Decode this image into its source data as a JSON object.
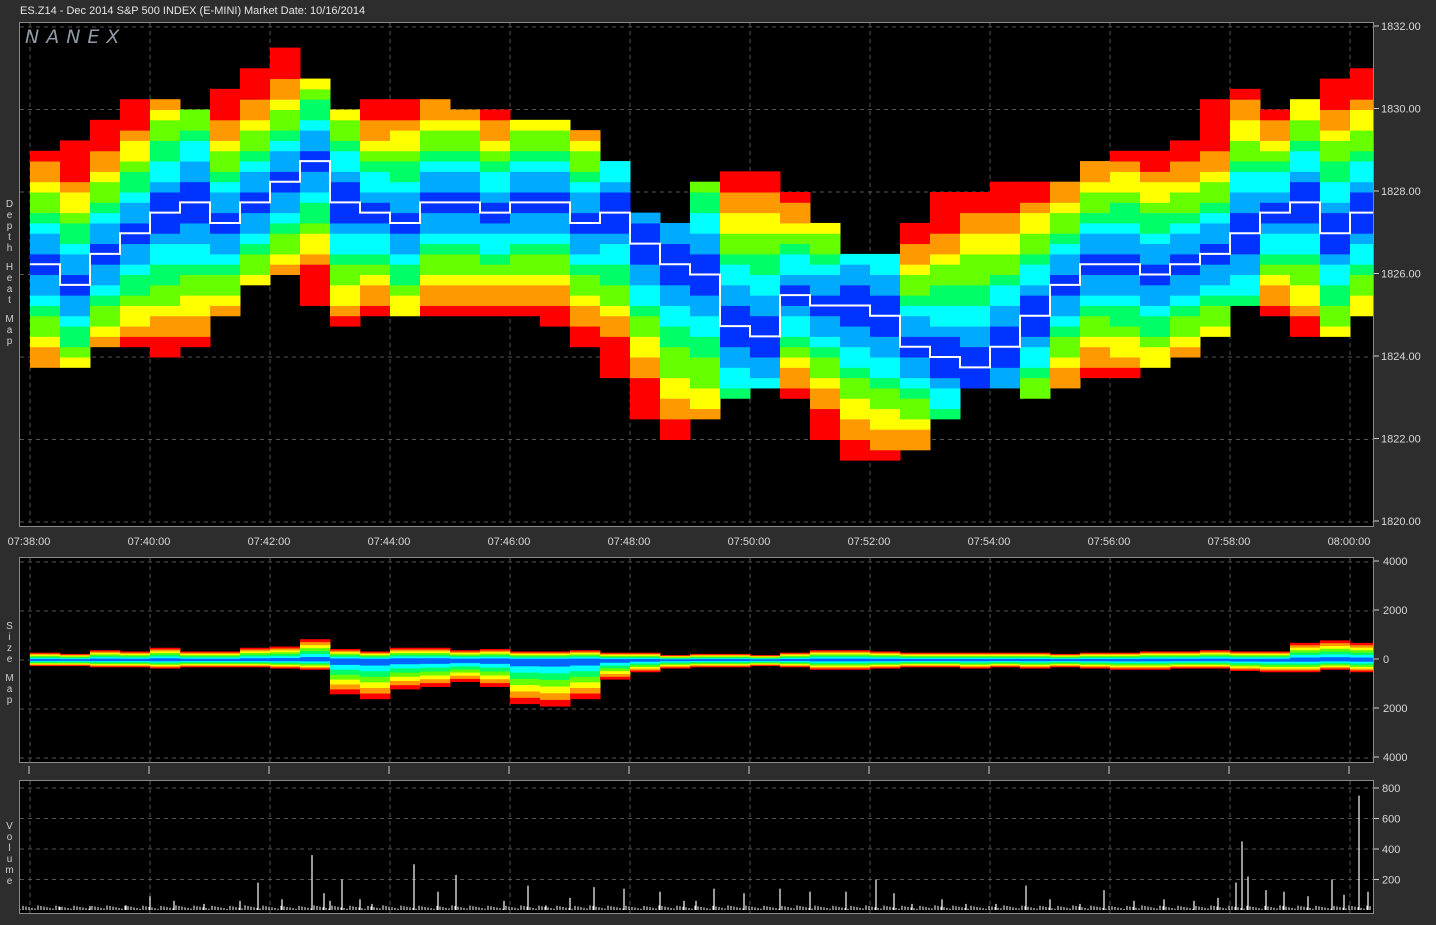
{
  "header": {
    "symbol_title": "ES.Z14 - Dec 2014 S&P 500 INDEX (E-MINI)",
    "market_date": "Market Date: 10/16/2014"
  },
  "logo": "NANEX",
  "panels": {
    "heat_label": "Depth Heat Map",
    "size_label": "Size Map",
    "volume_label": "Volume"
  },
  "colors": {
    "background": "#000000",
    "frame": "#2d2d2d",
    "grid": "#555555",
    "price_line": "#ffffff",
    "heat_scale": [
      "#0033ff",
      "#00aaff",
      "#00ffff",
      "#00ff66",
      "#66ff00",
      "#ffff00",
      "#ff9900",
      "#ff0000"
    ]
  },
  "chart_data": [
    {
      "type": "heatmap",
      "title": "Depth Heat Map",
      "x_ticks": [
        "07:38:00",
        "07:40:00",
        "07:42:00",
        "07:44:00",
        "07:46:00",
        "07:48:00",
        "07:50:00",
        "07:52:00",
        "07:54:00",
        "07:56:00",
        "07:58:00",
        "08:00:00"
      ],
      "y_ticks": [
        "1832.00",
        "1830.00",
        "1828.00",
        "1826.00",
        "1824.00",
        "1822.00",
        "1820.00"
      ],
      "ylim": [
        1820,
        1832
      ],
      "xlim_minutes": [
        0,
        22.5
      ],
      "price_path": {
        "minutes": [
          0,
          0.5,
          1,
          1.5,
          2,
          2.5,
          3,
          3.5,
          4,
          4.5,
          5,
          5.5,
          6,
          6.5,
          7,
          7.5,
          8,
          8.5,
          9,
          9.5,
          10,
          10.5,
          11,
          11.5,
          12,
          12.5,
          13,
          13.5,
          14,
          14.5,
          15,
          15.5,
          16,
          16.5,
          17,
          17.5,
          18,
          18.5,
          19,
          19.5,
          20,
          20.5,
          21,
          21.5,
          22,
          22.5
        ],
        "price": [
          1826.25,
          1825.75,
          1826.5,
          1827.0,
          1827.5,
          1827.75,
          1827.25,
          1827.75,
          1828.25,
          1828.75,
          1827.75,
          1827.5,
          1827.25,
          1827.75,
          1827.75,
          1827.5,
          1827.75,
          1827.75,
          1827.25,
          1827.5,
          1826.75,
          1826.25,
          1826.0,
          1824.75,
          1824.5,
          1825.5,
          1825.25,
          1825.25,
          1825.0,
          1824.25,
          1824.0,
          1823.75,
          1824.25,
          1825.0,
          1825.75,
          1826.25,
          1826.25,
          1826.0,
          1826.25,
          1826.5,
          1827.0,
          1827.5,
          1827.75,
          1827.0,
          1827.5,
          1828.0
        ]
      },
      "depth_range": {
        "low": [
          1823.75,
          1823.5,
          1824.0,
          1824.25,
          1824.0,
          1824.0,
          1824.5,
          1825.5,
          1826.0,
          1826.0,
          1824.5,
          1825.0,
          1825.0,
          1825.0,
          1825.0,
          1825.0,
          1825.0,
          1825.0,
          1824.5,
          1824.0,
          1823.0,
          1822.0,
          1821.75,
          1823.0,
          1823.0,
          1823.25,
          1822.5,
          1821.5,
          1821.25,
          1821.5,
          1822.0,
          1823.0,
          1823.5,
          1823.0,
          1823.0,
          1823.5,
          1823.25,
          1823.5,
          1824.0,
          1824.0,
          1825.0,
          1825.5,
          1824.5,
          1824.25,
          1824.5,
          1825.5
        ],
        "high": [
          1829.0,
          1828.75,
          1829.25,
          1830.0,
          1830.25,
          1830.0,
          1830.0,
          1830.5,
          1831.0,
          1831.75,
          1829.5,
          1830.0,
          1830.25,
          1830.25,
          1830.0,
          1830.0,
          1829.75,
          1829.75,
          1829.5,
          1829.0,
          1828.0,
          1826.5,
          1827.5,
          1828.5,
          1828.5,
          1828.0,
          1827.5,
          1826.5,
          1826.0,
          1826.5,
          1827.5,
          1828.0,
          1828.0,
          1828.25,
          1828.0,
          1828.25,
          1829.0,
          1829.0,
          1829.0,
          1829.25,
          1830.75,
          1830.0,
          1829.75,
          1830.5,
          1830.75,
          1831.0
        ]
      }
    },
    {
      "type": "area",
      "title": "Size Map",
      "y_ticks": [
        "4000",
        "2000",
        "0",
        "2000",
        "4000"
      ],
      "ylim": [
        -4000,
        4000
      ],
      "positive_size": [
        300,
        250,
        400,
        350,
        500,
        350,
        350,
        500,
        550,
        850,
        450,
        350,
        500,
        500,
        400,
        450,
        350,
        350,
        400,
        300,
        300,
        200,
        250,
        250,
        200,
        300,
        400,
        400,
        350,
        300,
        300,
        300,
        300,
        300,
        250,
        300,
        300,
        350,
        350,
        400,
        350,
        350,
        700,
        800,
        700,
        800
      ],
      "negative_size": [
        -250,
        -250,
        -300,
        -300,
        -350,
        -300,
        -300,
        -300,
        -350,
        -400,
        -1400,
        -1600,
        -1200,
        -1100,
        -900,
        -1100,
        -1800,
        -1900,
        -1600,
        -800,
        -500,
        -350,
        -300,
        -300,
        -250,
        -300,
        -400,
        -400,
        -350,
        -300,
        -300,
        -350,
        -300,
        -350,
        -300,
        -350,
        -400,
        -400,
        -350,
        -350,
        -450,
        -500,
        -500,
        -400,
        -500,
        -500
      ]
    },
    {
      "type": "bar",
      "title": "Volume",
      "y_ticks": [
        "800",
        "600",
        "400",
        "200"
      ],
      "ylim": [
        0,
        800
      ],
      "spikes": [
        {
          "m": 0.5,
          "v": 20
        },
        {
          "m": 1.0,
          "v": 25
        },
        {
          "m": 1.6,
          "v": 30
        },
        {
          "m": 2.0,
          "v": 90
        },
        {
          "m": 2.4,
          "v": 60
        },
        {
          "m": 2.9,
          "v": 40
        },
        {
          "m": 3.5,
          "v": 60
        },
        {
          "m": 3.8,
          "v": 180
        },
        {
          "m": 4.2,
          "v": 70
        },
        {
          "m": 4.7,
          "v": 360
        },
        {
          "m": 4.9,
          "v": 110
        },
        {
          "m": 5.0,
          "v": 60
        },
        {
          "m": 5.2,
          "v": 200
        },
        {
          "m": 5.5,
          "v": 70
        },
        {
          "m": 5.7,
          "v": 40
        },
        {
          "m": 6.4,
          "v": 300
        },
        {
          "m": 6.8,
          "v": 120
        },
        {
          "m": 7.1,
          "v": 230
        },
        {
          "m": 7.9,
          "v": 60
        },
        {
          "m": 8.3,
          "v": 160
        },
        {
          "m": 8.6,
          "v": 30
        },
        {
          "m": 9.0,
          "v": 80
        },
        {
          "m": 9.4,
          "v": 150
        },
        {
          "m": 9.9,
          "v": 140
        },
        {
          "m": 10.5,
          "v": 120
        },
        {
          "m": 10.9,
          "v": 60
        },
        {
          "m": 11.1,
          "v": 60
        },
        {
          "m": 11.4,
          "v": 140
        },
        {
          "m": 11.9,
          "v": 110
        },
        {
          "m": 12.5,
          "v": 140
        },
        {
          "m": 13.0,
          "v": 120
        },
        {
          "m": 13.6,
          "v": 120
        },
        {
          "m": 14.1,
          "v": 200
        },
        {
          "m": 14.4,
          "v": 110
        },
        {
          "m": 14.7,
          "v": 40
        },
        {
          "m": 15.2,
          "v": 70
        },
        {
          "m": 15.6,
          "v": 40
        },
        {
          "m": 16.1,
          "v": 40
        },
        {
          "m": 16.6,
          "v": 160
        },
        {
          "m": 17.0,
          "v": 70
        },
        {
          "m": 17.5,
          "v": 40
        },
        {
          "m": 17.9,
          "v": 130
        },
        {
          "m": 18.4,
          "v": 60
        },
        {
          "m": 18.9,
          "v": 70
        },
        {
          "m": 19.4,
          "v": 60
        },
        {
          "m": 19.8,
          "v": 80
        },
        {
          "m": 20.1,
          "v": 180
        },
        {
          "m": 20.2,
          "v": 450
        },
        {
          "m": 20.3,
          "v": 220
        },
        {
          "m": 20.6,
          "v": 130
        },
        {
          "m": 20.9,
          "v": 120
        },
        {
          "m": 21.3,
          "v": 90
        },
        {
          "m": 21.7,
          "v": 200
        },
        {
          "m": 21.9,
          "v": 100
        },
        {
          "m": 22.15,
          "v": 750
        },
        {
          "m": 22.3,
          "v": 120
        },
        {
          "m": 22.45,
          "v": 110
        }
      ]
    }
  ]
}
